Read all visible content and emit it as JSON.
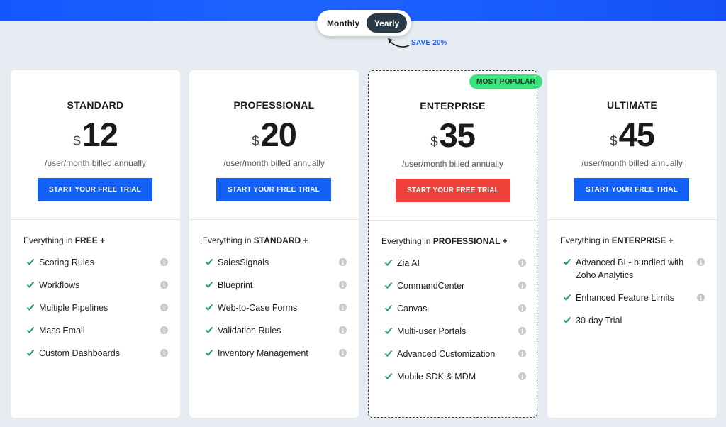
{
  "toggle": {
    "monthly": "Monthly",
    "yearly": "Yearly",
    "save_note": "SAVE 20%"
  },
  "colors": {
    "top_band": "#1f63ff",
    "cta_blue": "#1260f5",
    "cta_red": "#f0423a",
    "popular_badge": "#3ee27f",
    "check_green": "#20a060"
  },
  "plans": [
    {
      "name": "STANDARD",
      "currency": "$",
      "price": "12",
      "billing": "/user/month billed annually",
      "cta": "START YOUR FREE TRIAL",
      "includes_prefix": "Everything in",
      "includes_plan": "FREE +",
      "features": [
        "Scoring Rules",
        "Workflows",
        "Multiple Pipelines",
        "Mass Email",
        "Custom Dashboards"
      ]
    },
    {
      "name": "PROFESSIONAL",
      "currency": "$",
      "price": "20",
      "billing": "/user/month billed annually",
      "cta": "START YOUR FREE TRIAL",
      "includes_prefix": "Everything in",
      "includes_plan": "STANDARD +",
      "features": [
        "SalesSignals",
        "Blueprint",
        "Web-to-Case Forms",
        "Validation Rules",
        "Inventory Management"
      ]
    },
    {
      "name": "ENTERPRISE",
      "badge": "MOST POPULAR",
      "currency": "$",
      "price": "35",
      "billing": "/user/month billed annually",
      "cta": "START YOUR FREE TRIAL",
      "includes_prefix": "Everything in",
      "includes_plan": "PROFESSIONAL +",
      "features": [
        "Zia AI",
        "CommandCenter",
        "Canvas",
        "Multi-user Portals",
        "Advanced Customization",
        "Mobile SDK & MDM"
      ]
    },
    {
      "name": "ULTIMATE",
      "currency": "$",
      "price": "45",
      "billing": "/user/month billed annually",
      "cta": "START YOUR FREE TRIAL",
      "includes_prefix": "Everything in",
      "includes_plan": "ENTERPRISE +",
      "features": [
        "Advanced BI - bundled with Zoho Analytics",
        "Enhanced Feature Limits",
        "30-day Trial"
      ]
    }
  ]
}
